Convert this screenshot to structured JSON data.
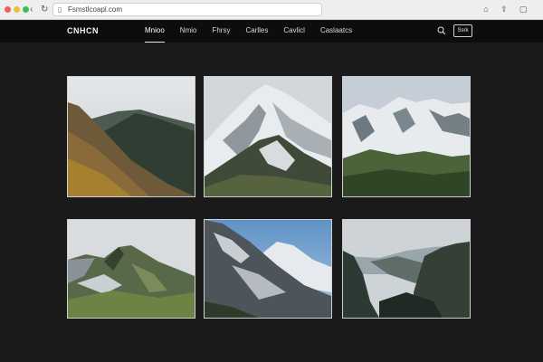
{
  "browser": {
    "url": "Fsmstlcoapl.com",
    "icons": {
      "back": "back-icon",
      "forward": "forward-icon",
      "reload": "reload-icon",
      "lock": "lock-icon",
      "extension": "extension-icon",
      "share": "share-icon",
      "tabs": "tabs-icon"
    }
  },
  "site": {
    "logo": "CNHCN",
    "nav": [
      {
        "label": "Mnioo",
        "active": true
      },
      {
        "label": "Nmio"
      },
      {
        "label": "Fhrsy"
      },
      {
        "label": "Carlles"
      },
      {
        "label": "Cavlicl"
      },
      {
        "label": "Caslaatcs"
      }
    ],
    "button_label": "Ssrk",
    "search_icon": "search-icon"
  },
  "gallery": {
    "tiles": [
      {
        "subject": "green-mountain-slope-cloudy-sky"
      },
      {
        "subject": "snowy-peak-grey-sky"
      },
      {
        "subject": "snowy-ridge-green-valley"
      },
      {
        "subject": "green-ridge-with-snow-patches"
      },
      {
        "subject": "rocky-snow-slope-blue-sky"
      },
      {
        "subject": "valley-between-cliffs"
      }
    ]
  },
  "colors": {
    "page_bg": "#1a1a1a",
    "header_bg": "#0d0d0d",
    "tile_border": "#cfcfcf"
  }
}
